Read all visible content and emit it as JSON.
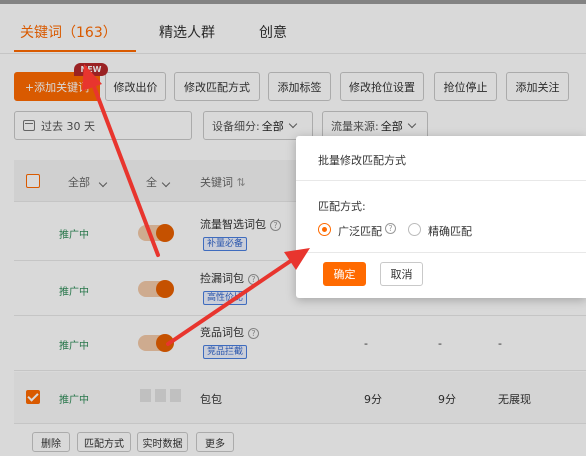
{
  "tabs": [
    {
      "label": "关键词（163）",
      "active": true
    },
    {
      "label": "精选人群",
      "active": false
    },
    {
      "label": "创意",
      "active": false
    }
  ],
  "toolbar": {
    "add_keyword": "+添加关键词",
    "new_badge": "NEW",
    "buttons": [
      "修改出价",
      "修改匹配方式",
      "添加标签",
      "修改抢位设置",
      "抢位停止",
      "添加关注"
    ]
  },
  "filters": {
    "date": "过去 30 天",
    "device_label": "设备细分:",
    "device_value": "全部",
    "source_label": "流量来源:",
    "source_value": "全部"
  },
  "table": {
    "headers": {
      "status": "全部",
      "switch": "全",
      "keyword": "关键词"
    },
    "rows": [
      {
        "status": "推广中",
        "keyword": "流量智选词包",
        "tag": "补量必备",
        "help": true,
        "c1": "",
        "c2": "",
        "c3": ""
      },
      {
        "status": "推广中",
        "keyword": "捡漏词包",
        "tag": "高性价比",
        "help": true,
        "c1": "",
        "c2": "",
        "c3": ""
      },
      {
        "status": "推广中",
        "keyword": "竞品词包",
        "tag": "竞品拦截",
        "help": true,
        "c1": "-",
        "c2": "-",
        "c3": "-"
      },
      {
        "status": "推广中",
        "keyword": "包包",
        "tag": "",
        "help": false,
        "c1": "9分",
        "c2": "9分",
        "c3": "无展现"
      }
    ]
  },
  "bottom_bar": [
    "删除",
    "匹配方式",
    "实时数据",
    "更多"
  ],
  "modal": {
    "title": "批量修改匹配方式",
    "label": "匹配方式:",
    "option_broad": "广泛匹配",
    "option_exact": "精确匹配",
    "confirm": "确定",
    "cancel": "取消"
  },
  "colors": {
    "accent": "#ff6a00",
    "status_green": "#2e8b57",
    "arrow_red": "#e8352e"
  }
}
